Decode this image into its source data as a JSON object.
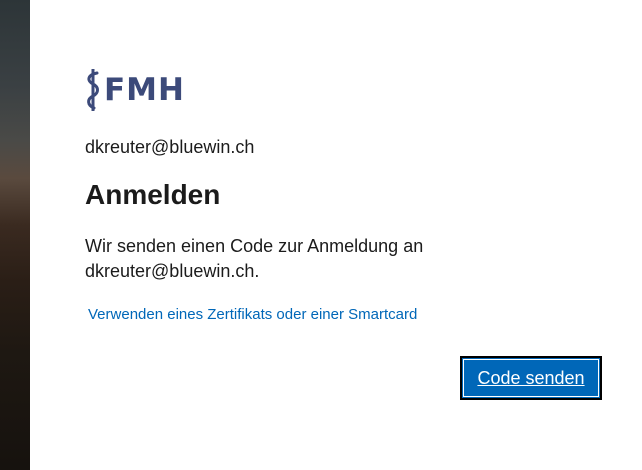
{
  "logo": {
    "text": "FMH",
    "color": "#3c4a7a"
  },
  "account": {
    "email": "dkreuter@bluewin.ch"
  },
  "heading": {
    "title": "Anmelden"
  },
  "message": {
    "text": "Wir senden einen Code zur Anmeldung an dkreuter@bluewin.ch."
  },
  "links": {
    "certificate": "Verwenden eines Zertifikats oder einer Smartcard"
  },
  "actions": {
    "send_code": "Code senden",
    "primary_color": "#0067b8"
  }
}
